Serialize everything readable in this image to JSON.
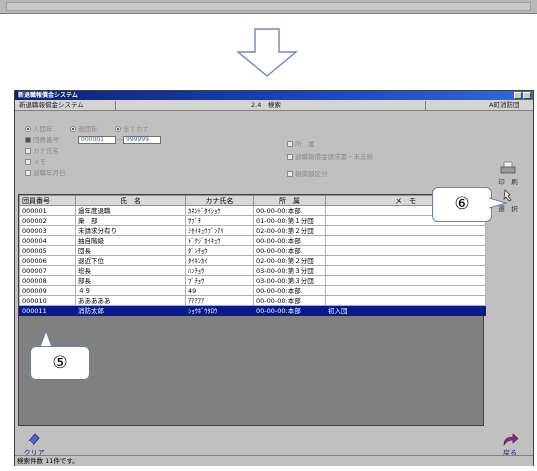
{
  "window": {
    "title": "新退職報償金システム",
    "app_name": "新退職報償金システム",
    "screen_id": "2.4　検索",
    "org": "A町消防団"
  },
  "criteria": {
    "radio1": "入団年",
    "radio2": "退団年",
    "radio3": "全てカナ",
    "check_member_no": "団員番号",
    "range_from": "000001",
    "range_tilde": "～",
    "range_to": "999999",
    "check_kana": "カナ氏名",
    "check_memo": "メモ",
    "check_retire": "退職年月日",
    "right_check1": "所　属",
    "right_check2": "退職報償金請求書・未支給",
    "right_check3": "報償額区分"
  },
  "side_buttons": {
    "print_label": "印　刷",
    "select_label": "選　択"
  },
  "table": {
    "headers": [
      "団員番号",
      "氏　名",
      "カナ氏名",
      "所　属",
      "メ　モ"
    ],
    "rows": [
      [
        "000001",
        "過年度退職",
        "ｶﾈﾝﾄﾞﾀｲｼｮｸ",
        "00-00-00:本部",
        ""
      ],
      [
        "000002",
        "衆　部",
        "ｻﾌﾞﾁ",
        "01-00-00:第１分団",
        ""
      ],
      [
        "000003",
        "未請求分有り",
        "ﾐｾｲｷｭｳﾌﾞﾝｱﾘ",
        "02-00-00:第２分団",
        ""
      ],
      [
        "000004",
        "抽自階級",
        "ﾄﾞｸｼﾞｶｲｷｭｳ",
        "00-00-00:本部",
        ""
      ],
      [
        "000005",
        "団長",
        "ﾀﾞﾝﾁｮｳ",
        "00-00-00:本部",
        ""
      ],
      [
        "000006",
        "退近下位",
        "ﾀｲｷﾝｶｲ",
        "02-00-00:第２分団",
        ""
      ],
      [
        "000007",
        "班長",
        "ﾊﾝﾁｮｳ",
        "03-00-00:第３分団",
        ""
      ],
      [
        "000008",
        "部長",
        "ﾌﾞﾁｮｳ",
        "03-00-00:第３分団",
        ""
      ],
      [
        "000009",
        "４９",
        "49",
        "00-00-00:本部",
        ""
      ],
      [
        "000010",
        "あああああ",
        "ｱｱｱｱｱ",
        "00-00-00:本部",
        ""
      ],
      [
        "000011",
        "消防太郎",
        "ｼｮｳﾎﾞｳﾀﾛｳ",
        "00-00-00:本部",
        "初入団"
      ]
    ],
    "selected_row": 10
  },
  "bottom": {
    "clear_label": "クリア",
    "back_label": "戻る",
    "status": "検索件数 11件です。"
  },
  "callouts": {
    "five": "⑤",
    "six": "⑥"
  },
  "colors": {
    "selected_row": "#0a1a8c",
    "title_bar": "#1848c8",
    "callout_border": "#6b7fa8"
  }
}
